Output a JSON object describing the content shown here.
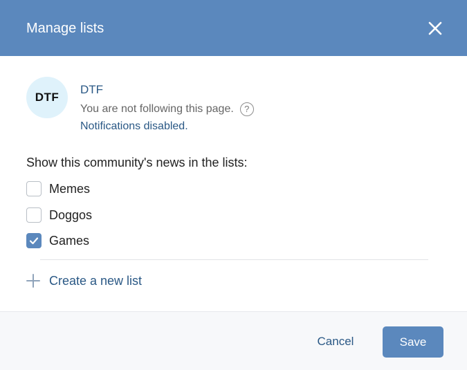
{
  "dialog": {
    "title": "Manage lists"
  },
  "community": {
    "avatar_text": "DTF",
    "name": "DTF",
    "follow_status": "You are not following this page.",
    "help_glyph": "?",
    "notifications_link": "Notifications disabled."
  },
  "lists": {
    "heading": "Show this community's news in the lists:",
    "items": [
      {
        "label": "Memes",
        "checked": false
      },
      {
        "label": "Doggos",
        "checked": false
      },
      {
        "label": "Games",
        "checked": true
      }
    ],
    "create_label": "Create a new list"
  },
  "footer": {
    "cancel_label": "Cancel",
    "save_label": "Save"
  },
  "colors": {
    "header_bg": "#5b88bd",
    "link": "#2a5885",
    "primary_button": "#5b88bd",
    "avatar_bg": "#dff2fb"
  },
  "icons": [
    "close-icon",
    "help-icon",
    "checkmark-icon",
    "plus-icon"
  ]
}
